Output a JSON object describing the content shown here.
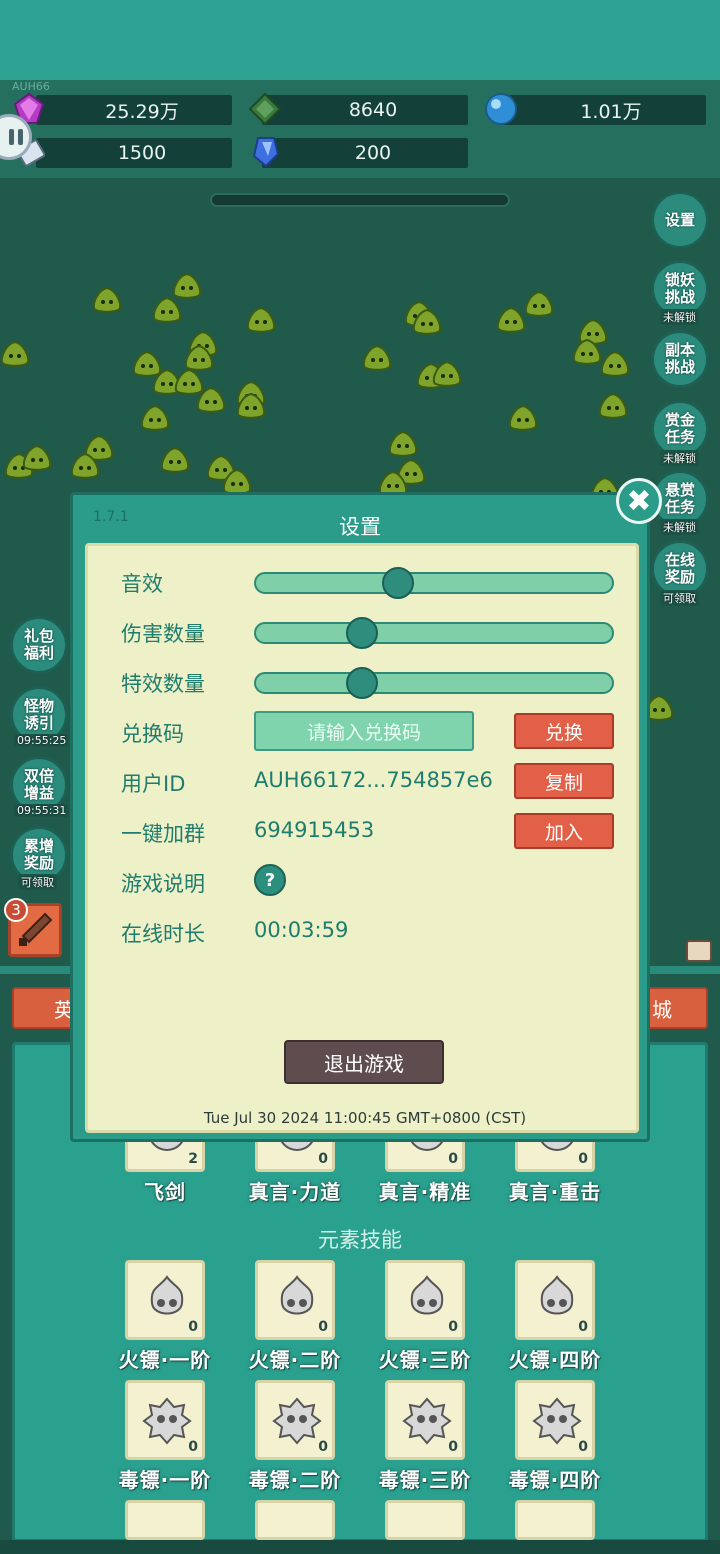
{
  "header": {
    "tiny_tag": "AUH66",
    "resources": [
      {
        "name": "purple-gem",
        "value": "25.29万"
      },
      {
        "name": "green-gem",
        "value": "8640"
      },
      {
        "name": "blue-orb",
        "value": "1.01万"
      },
      {
        "name": "scroll",
        "value": "1500"
      },
      {
        "name": "blue-crystal",
        "value": "200"
      }
    ]
  },
  "right_menu": {
    "settings": "设置",
    "lock_demon": "锁妖挑战",
    "lock_demon_sub": "未解锁",
    "dungeon": "副本挑战",
    "bounty": "赏金任务",
    "bounty_sub": "未解锁",
    "reward_task": "悬赏任务",
    "reward_task_sub": "未解锁",
    "online_reward": "在线奖励",
    "online_reward_sub": "可领取"
  },
  "left_menu": {
    "gift": "礼包福利",
    "monster_lure": "怪物诱引",
    "monster_lure_timer": "09:55:25",
    "double_gain": "双倍增益",
    "double_gain_timer": "09:55:31",
    "accumulate": "累增奖励",
    "accumulate_sub": "可领取",
    "weapon_badge": "3"
  },
  "tabs": {
    "left": "英",
    "right": "城"
  },
  "dialog": {
    "version": "1.7.1",
    "title": "设置",
    "sound_label": "音效",
    "sound_level": 0.4,
    "damage_label": "伤害数量",
    "damage_level": 0.3,
    "effect_label": "特效数量",
    "effect_level": 0.3,
    "code_label": "兑换码",
    "code_placeholder": "请输入兑换码",
    "code_button": "兑换",
    "uid_label": "用户ID",
    "uid_value": "AUH66172...754857e6",
    "copy_button": "复制",
    "group_label": "一键加群",
    "group_value": "694915453",
    "join_button": "加入",
    "guide_label": "游戏说明",
    "guide_icon": "?",
    "online_label": "在线时长",
    "online_value": "00:03:59",
    "quit_button": "退出游戏",
    "timestamp": "Tue Jul 30 2024 11:00:45 GMT+0800 (CST)"
  },
  "skills": {
    "row1": [
      {
        "label": "飞剑",
        "count": "2"
      },
      {
        "label": "真言·力道",
        "count": "0"
      },
      {
        "label": "真言·精准",
        "count": "0"
      },
      {
        "label": "真言·重击",
        "count": "0"
      }
    ],
    "section_title": "元素技能",
    "row2": [
      {
        "label": "火镖·一阶",
        "count": "0"
      },
      {
        "label": "火镖·二阶",
        "count": "0"
      },
      {
        "label": "火镖·三阶",
        "count": "0"
      },
      {
        "label": "火镖·四阶",
        "count": "0"
      }
    ],
    "row3": [
      {
        "label": "毒镖·一阶",
        "count": "0"
      },
      {
        "label": "毒镖·二阶",
        "count": "0"
      },
      {
        "label": "毒镖·三阶",
        "count": "0"
      },
      {
        "label": "毒镖·四阶",
        "count": "0"
      }
    ]
  }
}
